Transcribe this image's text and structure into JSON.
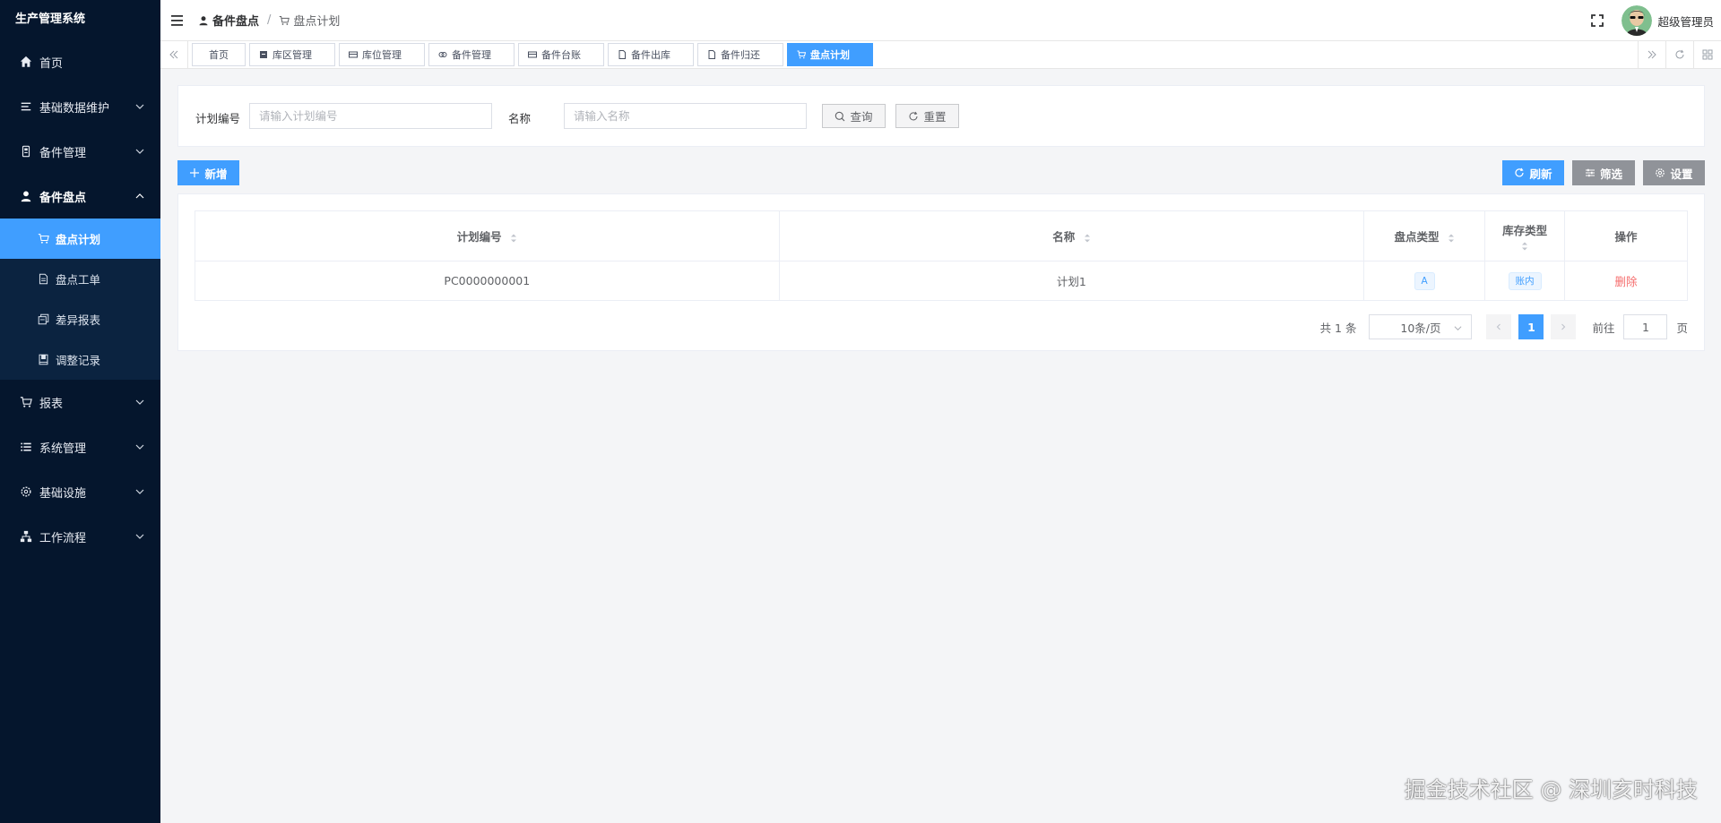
{
  "app": {
    "title": "生产管理系统"
  },
  "sidebar": {
    "items": [
      {
        "label": "首页",
        "icon": "home-icon"
      },
      {
        "label": "基础数据维护",
        "icon": "list-icon"
      },
      {
        "label": "备件管理",
        "icon": "parts-icon"
      },
      {
        "label": "备件盘点",
        "icon": "user-icon",
        "open": true
      },
      {
        "label": "报表",
        "icon": "cart-icon"
      },
      {
        "label": "系统管理",
        "icon": "menu-icon"
      },
      {
        "label": "基础设施",
        "icon": "gear-icon"
      },
      {
        "label": "工作流程",
        "icon": "flow-icon"
      }
    ],
    "submenu": [
      {
        "label": "盘点计划",
        "icon": "cart-icon",
        "active": true
      },
      {
        "label": "盘点工单",
        "icon": "doc-icon"
      },
      {
        "label": "差异报表",
        "icon": "copy-icon"
      },
      {
        "label": "调整记录",
        "icon": "book-icon"
      }
    ]
  },
  "header": {
    "breadcrumb": [
      "备件盘点",
      "/",
      "盘点计划"
    ],
    "username": "超级管理员"
  },
  "tags": [
    {
      "label": "首页"
    },
    {
      "label": "库区管理"
    },
    {
      "label": "库位管理"
    },
    {
      "label": "备件管理"
    },
    {
      "label": "备件台账"
    },
    {
      "label": "备件出库"
    },
    {
      "label": "备件归还"
    },
    {
      "label": "盘点计划",
      "active": true
    }
  ],
  "search": {
    "plan_no_label": "计划编号",
    "plan_no_placeholder": "请输入计划编号",
    "name_label": "名称",
    "name_placeholder": "请输入名称",
    "query_btn": "查询",
    "reset_btn": "重置"
  },
  "toolbar": {
    "add_btn": "新增",
    "refresh_btn": "刷新",
    "filter_btn": "筛选",
    "settings_btn": "设置"
  },
  "table": {
    "columns": [
      "计划编号",
      "名称",
      "盘点类型",
      "库存类型",
      "操作"
    ],
    "rows": [
      {
        "plan_no": "PC0000000001",
        "name": "计划1",
        "count_type": "A",
        "stock_type": "账内",
        "action": "删除"
      }
    ]
  },
  "pagination": {
    "total": "共 1 条",
    "page_size": "10条/页",
    "current": "1",
    "goto_label": "前往",
    "goto_value": "1",
    "page_unit": "页"
  },
  "watermark": "掘金技术社区 @ 深圳亥时科技",
  "colors": {
    "primary": "#409eff",
    "sidebar": "#05162d",
    "danger": "#f56c6c"
  }
}
